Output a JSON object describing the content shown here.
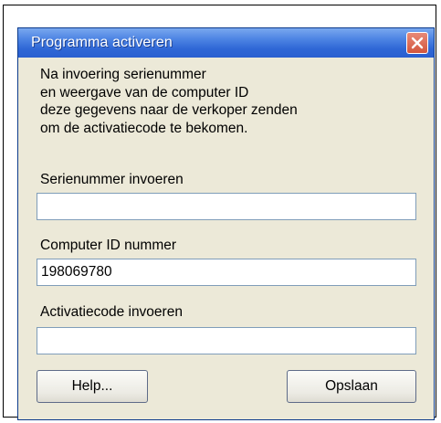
{
  "window": {
    "title": "Programma activeren"
  },
  "instructions": [
    "Na invoering serienummer",
    "en weergave van de computer ID",
    "deze gegevens naar de verkoper zenden",
    "om de activatiecode te bekomen."
  ],
  "fields": {
    "serial": {
      "label": "Serienummer invoeren",
      "value": ""
    },
    "computer_id": {
      "label": "Computer ID nummer",
      "value": "198069780"
    },
    "activation": {
      "label": "Activatiecode invoeren",
      "value": ""
    }
  },
  "buttons": {
    "help": "Help...",
    "save": "Opslaan"
  },
  "icons": {
    "close": "close-icon"
  },
  "colors": {
    "titlebar": "#2f67d6",
    "close_button": "#d3553c",
    "dialog_bg": "#ece9d8"
  }
}
